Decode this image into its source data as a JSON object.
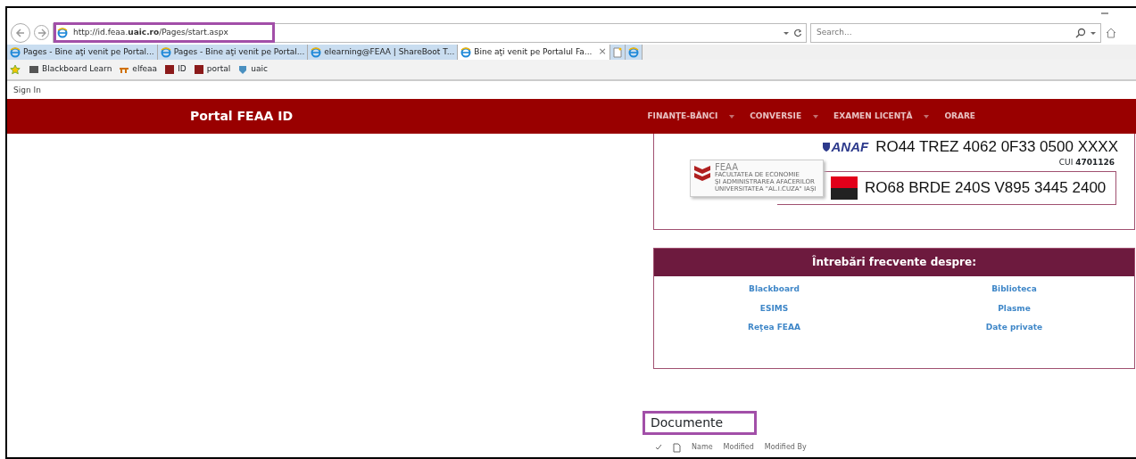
{
  "browser": {
    "address": {
      "url": "http://id.feaa.**uaic.ro**/Pages/start.aspx",
      "highlighted": true
    },
    "search": {
      "placeholder": "Search..."
    },
    "tabs": [
      {
        "label": "Pages - Bine aţi venit pe Portal...",
        "selected": false,
        "closable": false
      },
      {
        "label": "Pages - Bine aţi venit pe Portal...",
        "selected": false,
        "closable": false
      },
      {
        "label": "elearning@FEAA | ShareBoot T...",
        "selected": false,
        "closable": false
      },
      {
        "label": "Bine aţi venit pe Portalul Fa...",
        "selected": true,
        "closable": true
      }
    ],
    "tab_close": "×",
    "favorites": [
      "Blackboard Learn",
      "elfeaa",
      "ID",
      "portal",
      "uaic"
    ]
  },
  "page": {
    "sign_in": "Sign In",
    "site_title": "Portal FEAA ID",
    "nav": [
      {
        "label": "FINANŢE-BĂNCI",
        "dropdown": true
      },
      {
        "label": "CONVERSIE",
        "dropdown": true
      },
      {
        "label": "EXAMEN LICENŢĂ",
        "dropdown": true
      },
      {
        "label": "ORARE",
        "dropdown": false
      }
    ],
    "banner": {
      "anaf_logo": "ANAF",
      "iban_treasury": "RO44 TREZ 4062 0F33 0500 XXXX",
      "cui": "CUI **4701126**",
      "iban_bank": "RO68 BRDE 240S V895 3445 2400",
      "feaa_logo": {
        "name": "FEAA",
        "lines": [
          "FACULTATEA DE ECONOMIE",
          "ŞI ADMINISTRAREA AFACERILOR",
          "UNIVERSITATEA \"AL.I.CUZA\" IAŞI"
        ]
      }
    },
    "faq": {
      "title": "Întrebări frecvente despre:",
      "links": [
        [
          "Blackboard",
          "Biblioteca"
        ],
        [
          "ESIMS",
          "Plasme"
        ],
        [
          "Reţea FEAA",
          "Date private"
        ]
      ]
    },
    "documents": {
      "title": "Documente",
      "highlighted": true,
      "columns": [
        "Name",
        "Modified",
        "Modified By"
      ]
    }
  }
}
